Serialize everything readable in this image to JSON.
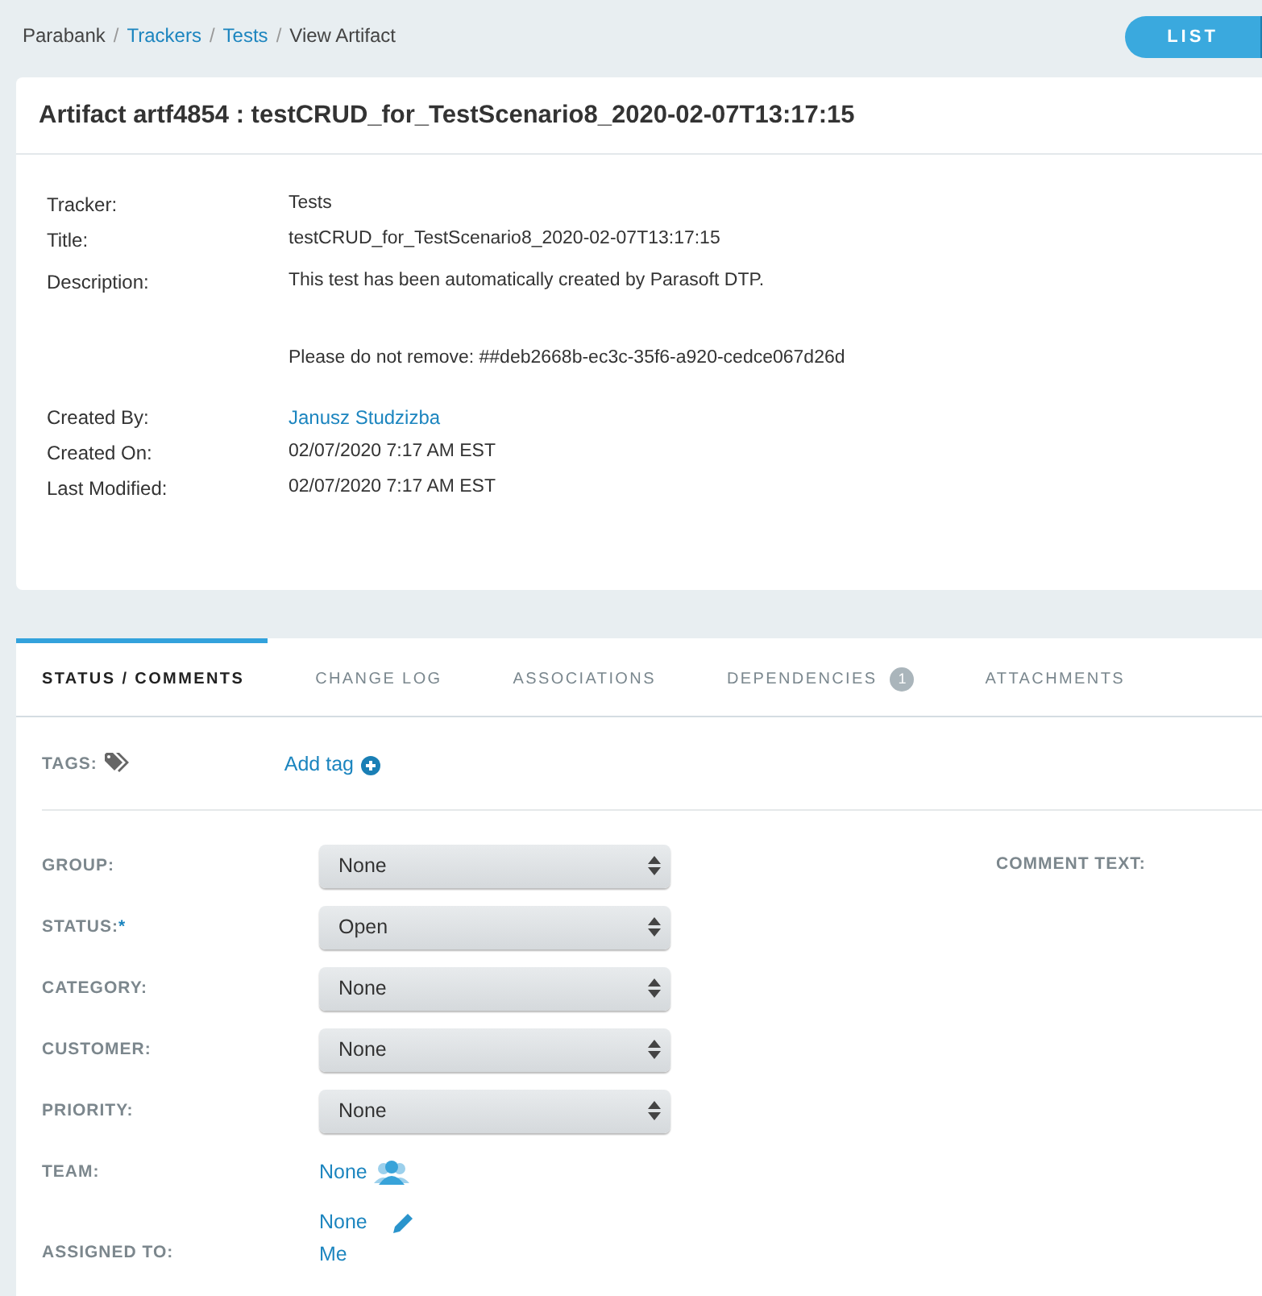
{
  "breadcrumb": [
    {
      "label": "Parabank",
      "kind": "text"
    },
    {
      "label": "Trackers",
      "kind": "link"
    },
    {
      "label": "Tests",
      "kind": "link"
    },
    {
      "label": "View Artifact",
      "kind": "text"
    }
  ],
  "breadcrumb_separator": "/",
  "required_mark": "*",
  "list_button": "LIST",
  "artifact": {
    "title": "Artifact artf4854 : testCRUD_for_TestScenario8_2020-02-07T13:17:15",
    "details": [
      {
        "label": "Tracker:",
        "kind": "text",
        "value": [
          "Tests"
        ]
      },
      {
        "label": "Title:",
        "kind": "text",
        "value": [
          "testCRUD_for_TestScenario8_2020-02-07T13:17:15"
        ]
      },
      {
        "label": "Description:",
        "kind": "text",
        "value": [
          "This test has been automatically created by Parasoft DTP.",
          "Please do not remove: ##deb2668b-ec3c-35f6-a920-cedce067d26d"
        ]
      },
      {
        "label": "Created By:",
        "kind": "link",
        "value": [
          "Janusz Studzizba"
        ]
      },
      {
        "label": "Created On:",
        "kind": "text",
        "value": [
          "02/07/2020 7:17 AM EST"
        ]
      },
      {
        "label": "Last Modified:",
        "kind": "text",
        "value": [
          "02/07/2020 7:17 AM EST"
        ]
      }
    ]
  },
  "tabs": [
    {
      "label": "STATUS / COMMENTS",
      "selected": true
    },
    {
      "label": "CHANGE LOG",
      "selected": false
    },
    {
      "label": "ASSOCIATIONS",
      "selected": false
    },
    {
      "label": "DEPENDENCIES",
      "selected": false,
      "badge": "1"
    },
    {
      "label": "ATTACHMENTS",
      "selected": false
    }
  ],
  "tags": {
    "label": "TAGS:",
    "add": "Add tag"
  },
  "fields": [
    {
      "label": "GROUP:",
      "required": false,
      "kind": "select",
      "value": "None"
    },
    {
      "label": "STATUS:",
      "required": true,
      "kind": "select",
      "value": "Open"
    },
    {
      "label": "CATEGORY:",
      "required": false,
      "kind": "select",
      "value": "None"
    },
    {
      "label": "CUSTOMER:",
      "required": false,
      "kind": "select",
      "value": "None"
    },
    {
      "label": "PRIORITY:",
      "required": false,
      "kind": "select",
      "value": "None"
    },
    {
      "label": "TEAM:",
      "required": false,
      "kind": "team",
      "value": "None"
    },
    {
      "label": "ASSIGNED TO:",
      "required": false,
      "kind": "assign",
      "value": "None",
      "extra": "Me"
    }
  ],
  "comment_label": "COMMENT TEXT:"
}
